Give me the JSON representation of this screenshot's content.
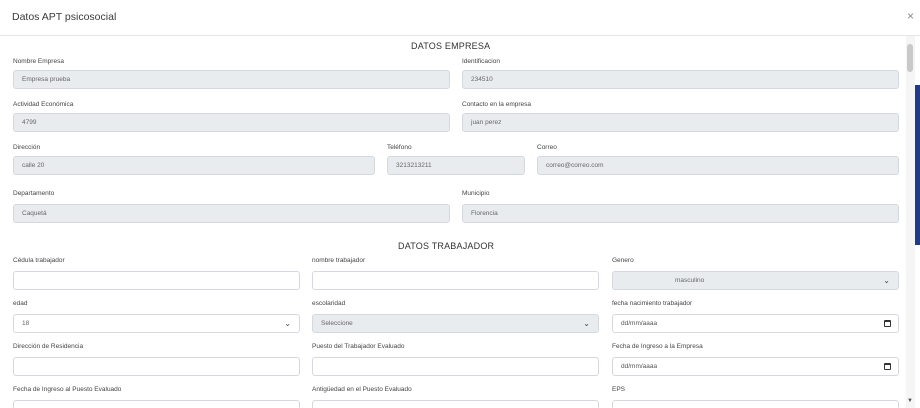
{
  "header": {
    "title": "Datos APT psicosocial",
    "close": "×"
  },
  "sections": {
    "empresa": "DATOS EMPRESA",
    "trabajador": "DATOS TRABAJADOR"
  },
  "empresa": {
    "nombre_label": "Nombre Empresa",
    "nombre_value": "Empresa prueba",
    "identificacion_label": "Identificacion",
    "identificacion_value": "234510",
    "actividad_label": "Actividad Económica",
    "actividad_value": "4799",
    "contacto_label": "Contacto en la empresa",
    "contacto_value": "juan perez",
    "direccion_label": "Dirección",
    "direccion_value": "calle 20",
    "telefono_label": "Teléfono",
    "telefono_value": "3213213211",
    "correo_label": "Correo",
    "correo_value": "correo@correo.com",
    "departamento_label": "Departamento",
    "departamento_value": "Caquetá",
    "municipio_label": "Municipio",
    "municipio_value": "Florencia"
  },
  "trabajador": {
    "cedula_label": "Cédula trabajador",
    "cedula_value": "",
    "nombre_label": "nombre trabajador",
    "nombre_value": "",
    "genero_label": "Genero",
    "genero_value": "masculino",
    "edad_label": "edad",
    "edad_value": "18",
    "escolaridad_label": "escolaridad",
    "escolaridad_value": "Seleccione",
    "fecha_nac_label": "fecha nacimiento trabajador",
    "fecha_nac_value": "dd/mm/aaaa",
    "direccion_res_label": "Dirección de Residencia",
    "direccion_res_value": "",
    "puesto_label": "Puesto del Trabajador Evaluado",
    "puesto_value": "",
    "fecha_ingreso_empresa_label": "Fecha de Ingreso a la Empresa",
    "fecha_ingreso_empresa_value": "dd/mm/aaaa",
    "fecha_ingreso_puesto_label": "Fecha de Ingreso al Puesto Evaluado",
    "antiguedad_label": "Antigüedad en el Puesto Evaluado",
    "eps_label": "EPS"
  },
  "icons": {
    "select": "chevron-down-icon",
    "date": "calendar-icon",
    "close": "close-icon"
  },
  "colors": {
    "readonly_bg": "#e9ecef",
    "border": "#d5d8de",
    "side_accent": "#1f3b8a"
  }
}
